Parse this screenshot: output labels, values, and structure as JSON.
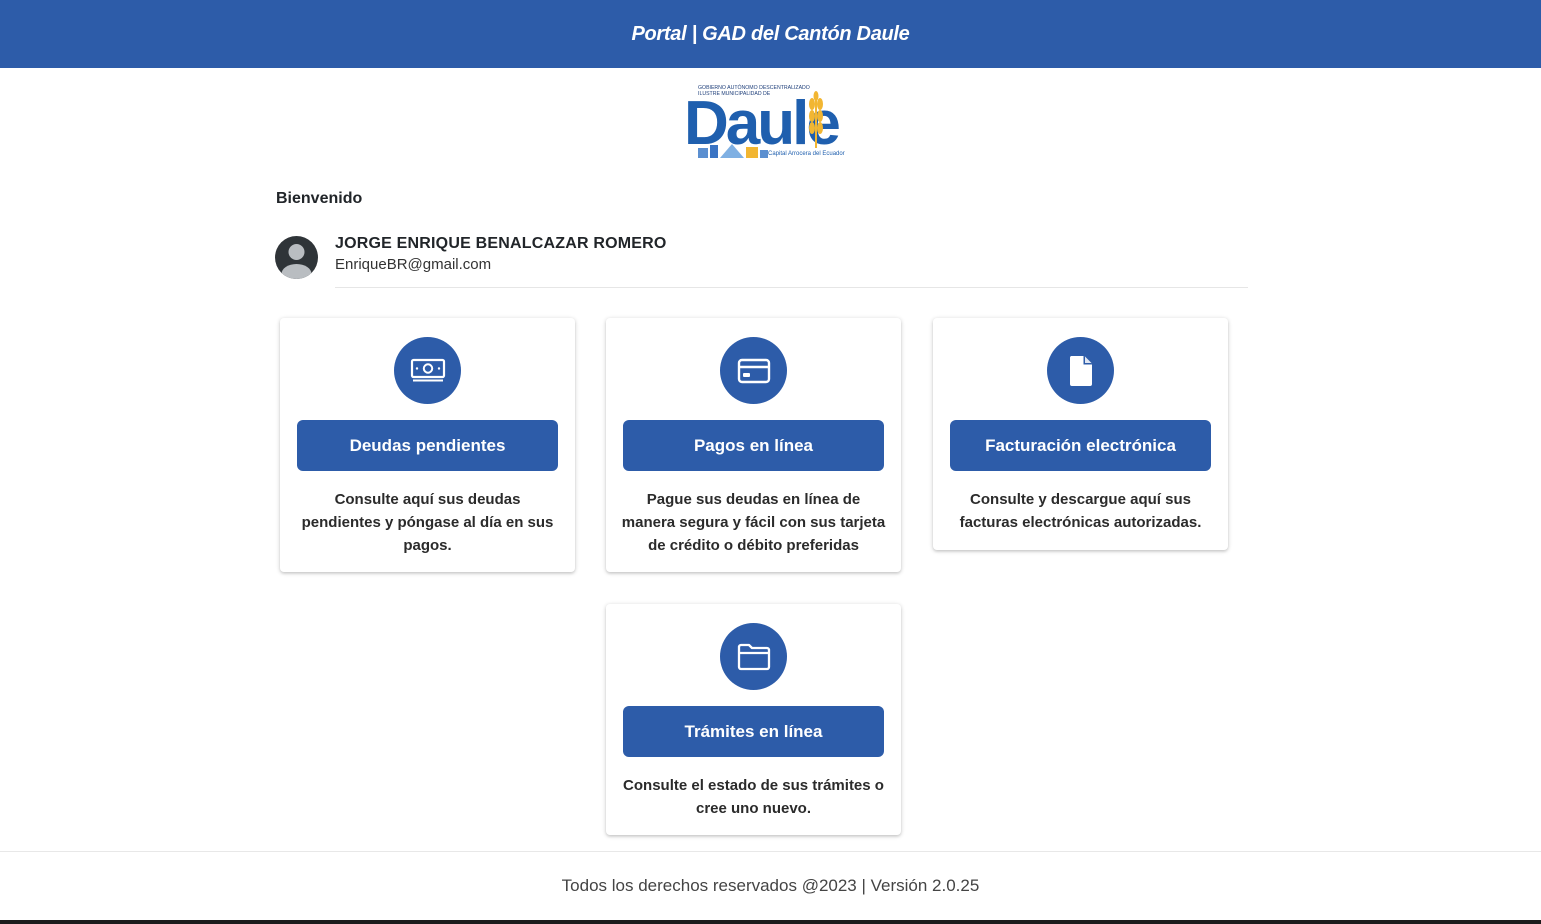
{
  "header": {
    "title": "Portal | GAD del Cantón Daule"
  },
  "logo": {
    "top_text_1": "GOBIERNO AUTÓNOMO DESCENTRALIZADO",
    "top_text_2": "ILUSTRE MUNICIPALIDAD DE",
    "word": "Daule",
    "tagline": "Capital Arrocera del Ecuador"
  },
  "welcome": "Bienvenido",
  "user": {
    "name": "JORGE ENRIQUE BENALCAZAR ROMERO",
    "email": "EnriqueBR@gmail.com",
    "avatar_icon": "user-avatar-icon"
  },
  "cards": [
    {
      "icon": "money-icon",
      "button_label": "Deudas pendientes",
      "description": "Consulte aquí sus deudas pendientes y póngase al día en sus pagos."
    },
    {
      "icon": "credit-card-icon",
      "button_label": "Pagos en línea",
      "description": "Pague sus deudas en línea de manera segura y fácil con sus tarjeta de crédito o débito preferidas"
    },
    {
      "icon": "document-icon",
      "button_label": "Facturación electrónica",
      "description": "Consulte y descargue aquí sus facturas electrónicas autorizadas."
    },
    {
      "icon": "folder-icon",
      "button_label": "Trámites en línea",
      "description": "Consulte el estado de sus trámites o cree uno nuevo."
    }
  ],
  "footer": {
    "text": "Todos los derechos reservados @2023 | Versión 2.0.25"
  },
  "colors": {
    "primary": "#2d5ca9",
    "logo_blue": "#1f5fae",
    "logo_gold": "#f2b632"
  }
}
